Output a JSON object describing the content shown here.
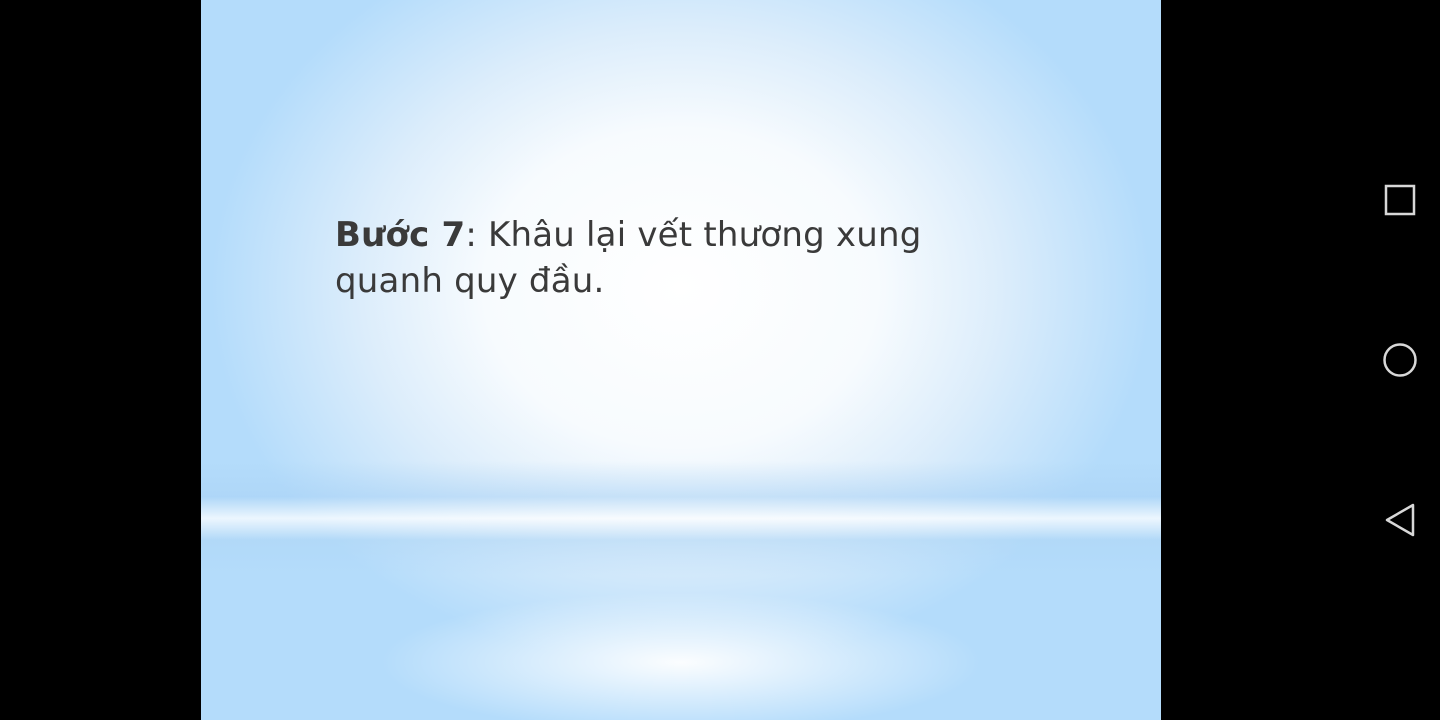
{
  "slide": {
    "step_label": "Bước 7",
    "step_text": ": Khâu lại vết thương xung quanh quy đầu."
  },
  "navigation_bar": {
    "buttons": [
      {
        "name": "recents",
        "icon": "square-icon"
      },
      {
        "name": "home",
        "icon": "circle-icon"
      },
      {
        "name": "back",
        "icon": "triangle-left-icon"
      }
    ],
    "icon_color": "#d8d8d8"
  },
  "colors": {
    "background": "#000000",
    "slide_edge": "#b4dcfb",
    "text": "#3a3a3a"
  }
}
